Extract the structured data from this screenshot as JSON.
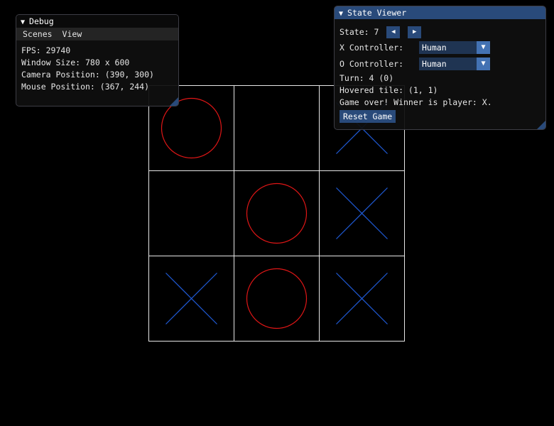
{
  "board": {
    "cells": [
      [
        "O",
        "",
        "X"
      ],
      [
        "",
        "O",
        "X"
      ],
      [
        "X",
        "O",
        "X"
      ]
    ],
    "colors": {
      "x": "#1f5bd8",
      "o": "#e01616",
      "grid": "#e6e6e6"
    }
  },
  "debug": {
    "title": "Debug",
    "menu": [
      "Scenes",
      "View"
    ],
    "fps": "FPS: 29740",
    "window_size": "Window Size: 780 x 600",
    "camera_position": "Camera Position: (390, 300)",
    "mouse_position": "Mouse Position: (367, 244)"
  },
  "state_viewer": {
    "title": "State Viewer",
    "state_label": "State: 7",
    "prev_icon": "◀",
    "next_icon": "▶",
    "x_controller_label": "X Controller:",
    "x_controller_value": "Human",
    "o_controller_label": "O Controller:",
    "o_controller_value": "Human",
    "turn": "Turn: 4 (0)",
    "hovered_tile": "Hovered tile: (1, 1)",
    "status": "Game over! Winner is player: X.",
    "reset_label": "Reset Game"
  },
  "icons": {
    "collapse": "▼",
    "dropdown": "▼"
  }
}
